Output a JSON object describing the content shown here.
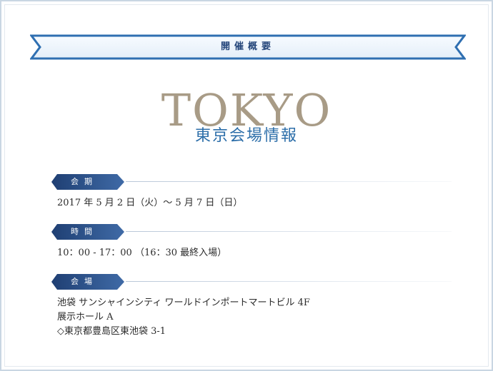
{
  "banner": {
    "label": "開催概要"
  },
  "hero": {
    "title": "TOKYO",
    "subtitle": "東京会場情報"
  },
  "sections": [
    {
      "tag": "会期",
      "lines": [
        "2017 年 5 月 2 日（火）～ 5 月 7 日（日）"
      ]
    },
    {
      "tag": "時間",
      "lines": [
        "10：00 - 17：00 （16：30 最終入場）"
      ]
    },
    {
      "tag": "会場",
      "lines": [
        "池袋 サンシャインシティ ワールドインポートマートビル 4F",
        "展示ホール A",
        "◇東京都豊島区東池袋 3-1"
      ]
    }
  ],
  "colors": {
    "banner_text": "#24467a",
    "banner_border": "#2f6fb1",
    "hero_title": "#a89b86",
    "hero_subtitle": "#2c6ea9",
    "tag_fill": "#2e5188"
  }
}
